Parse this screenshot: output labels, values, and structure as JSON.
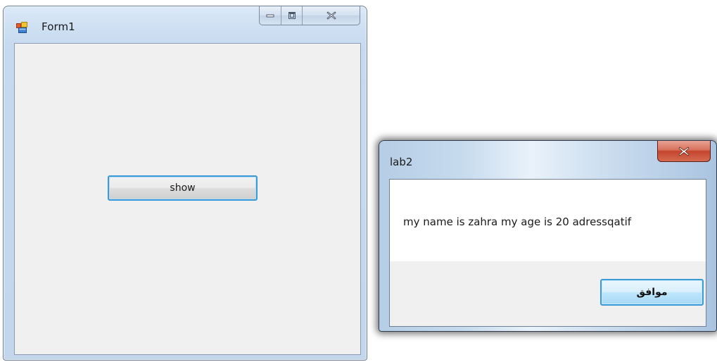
{
  "form1": {
    "title": "Form1",
    "icon": "winforms-app-icon",
    "caption_buttons": [
      "minimize-icon",
      "maximize-icon",
      "close-icon"
    ],
    "show_button_label": "show"
  },
  "messagebox": {
    "title": "lab2",
    "message": "my name is zahra my age is 20 adressqatif",
    "ok_button_label": "موافق",
    "close_icon": "close-icon"
  },
  "colors": {
    "focus_border": "#3c9ad7",
    "close_button_red": "#c4452d",
    "client_background": "#f0f0f0"
  }
}
